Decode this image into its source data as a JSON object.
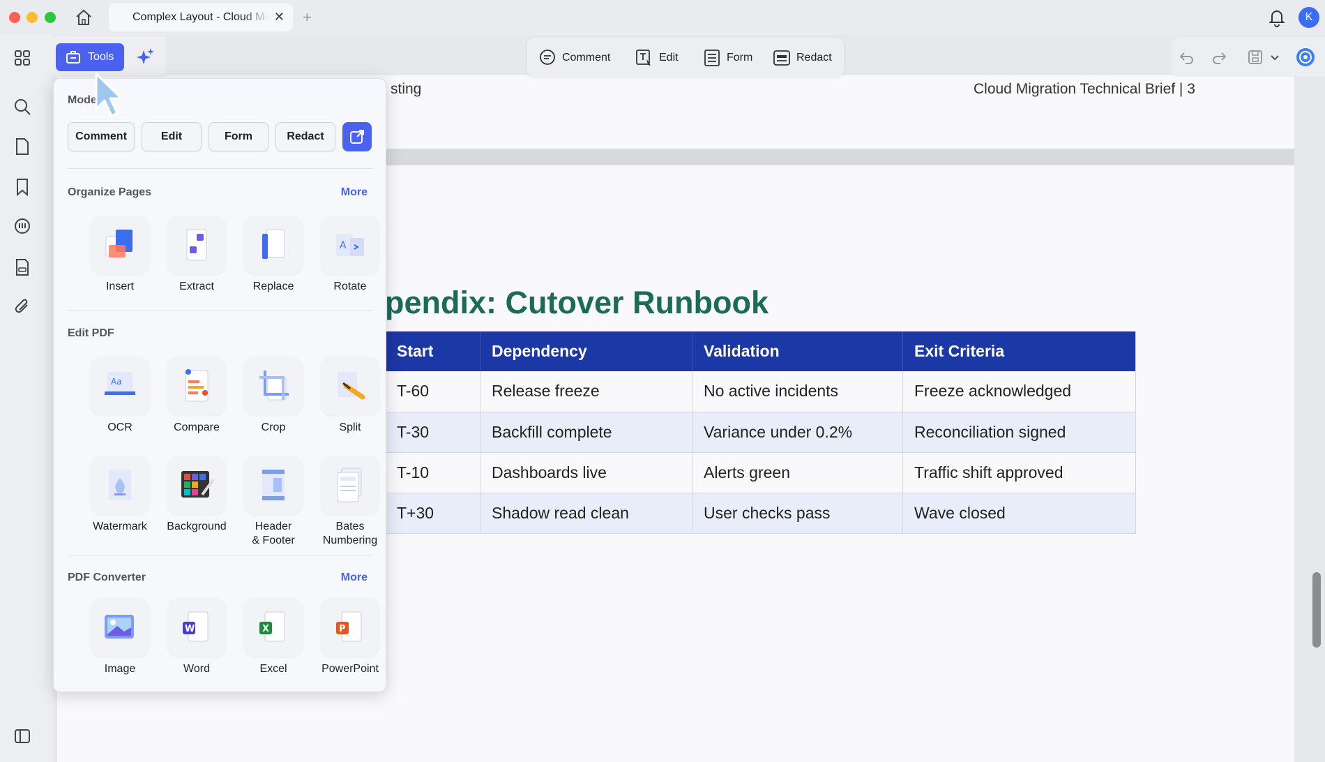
{
  "window": {
    "tab_title": "Complex Layout - Cloud Migration Technical Brief",
    "avatar_initial": "K"
  },
  "toolbar": {
    "tools_label": "Tools",
    "modes": [
      {
        "label": "Comment",
        "icon": "comment-icon"
      },
      {
        "label": "Edit",
        "icon": "edit-text-icon"
      },
      {
        "label": "Form",
        "icon": "form-icon"
      },
      {
        "label": "Redact",
        "icon": "redact-icon"
      }
    ]
  },
  "document": {
    "header_left": "sting",
    "header_right": "Cloud Migration Technical Brief | 3",
    "heading": "pendix: Cutover Runbook",
    "table": {
      "headers": [
        "Start",
        "Dependency",
        "Validation",
        "Exit Criteria"
      ],
      "rows": [
        [
          "T-60",
          "Release freeze",
          "No active incidents",
          "Freeze acknowledged"
        ],
        [
          "T-30",
          "Backfill complete",
          "Variance under 0.2%",
          "Reconciliation signed"
        ],
        [
          "T-10",
          "Dashboards live",
          "Alerts green",
          "Traffic shift approved"
        ],
        [
          "T+30",
          "Shadow read clean",
          "User checks pass",
          "Wave closed"
        ]
      ]
    }
  },
  "popup": {
    "mode_title": "Mode",
    "mode_buttons": [
      "Comment",
      "Edit",
      "Form",
      "Redact"
    ],
    "organize": {
      "title": "Organize Pages",
      "more": "More",
      "tools": [
        "Insert",
        "Extract",
        "Replace",
        "Rotate"
      ]
    },
    "edit_pdf": {
      "title": "Edit PDF",
      "tools_row1": [
        "OCR",
        "Compare",
        "Crop",
        "Split"
      ],
      "tools_row2": [
        "Watermark",
        "Background",
        "Header\n& Footer",
        "Bates\nNumbering"
      ]
    },
    "converter": {
      "title": "PDF Converter",
      "more": "More",
      "tools": [
        "Image",
        "Word",
        "Excel",
        "PowerPoint"
      ]
    }
  },
  "colors": {
    "accent": "#4b62f0",
    "heading_green": "#1b6b57",
    "table_header": "#1c37a6"
  }
}
